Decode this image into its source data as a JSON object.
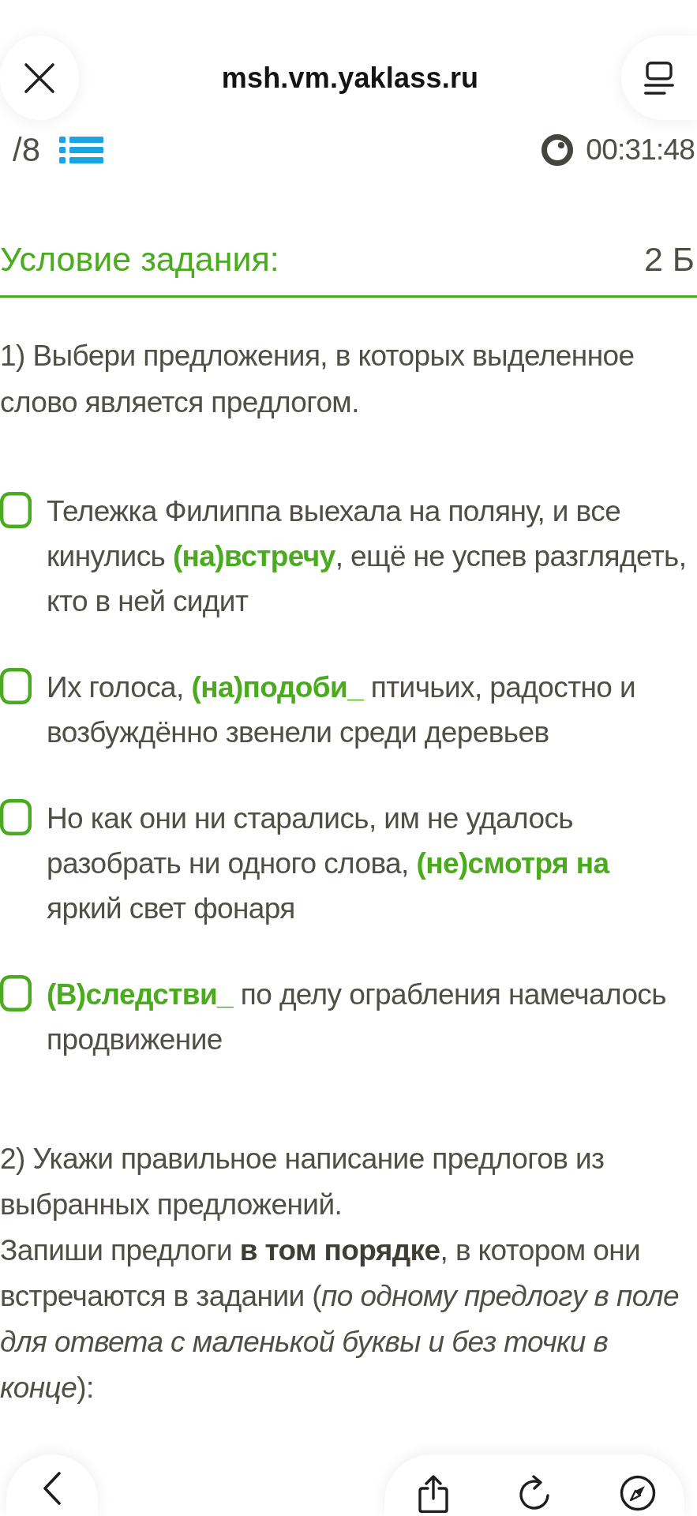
{
  "browser_bar": {
    "address": "msh.vm.yaklass.ru"
  },
  "task_header": {
    "progress": "/8",
    "timer": "00:31:48"
  },
  "condition": {
    "title": "Условие задания:",
    "points": "2 Б"
  },
  "question_1": {
    "prompt": "1) Выбери предложения, в которых выделенное слово является предлогом.",
    "options": [
      {
        "text": "Тележка Филиппа выехала на поляну, и все кинулись **(на)встречу**, ещё не успев разглядеть, кто в ней сидит",
        "checked": false
      },
      {
        "text": "Их голоса, **(на)подоби_** птичьих, радостно и возбуждённо звенели среди деревьев",
        "checked": false
      },
      {
        "text": "Но как они ни старались, им не удалось разобрать ни одного слова, **(не)смотря на** яркий свет фонаря",
        "checked": false
      },
      {
        "text": "**(В)следстви_** по делу ограбления намечалось продвижение",
        "checked": false
      }
    ]
  },
  "question_2": {
    "prompt": "2) Укажи правильное написание предлогов из выбранных предложений.",
    "instruction": "Запиши предлоги **в том порядке**, в котором они встречаются в задании (*по одному предлогу в поле для ответа с маленькой буквы и без точки в конце*):"
  }
}
